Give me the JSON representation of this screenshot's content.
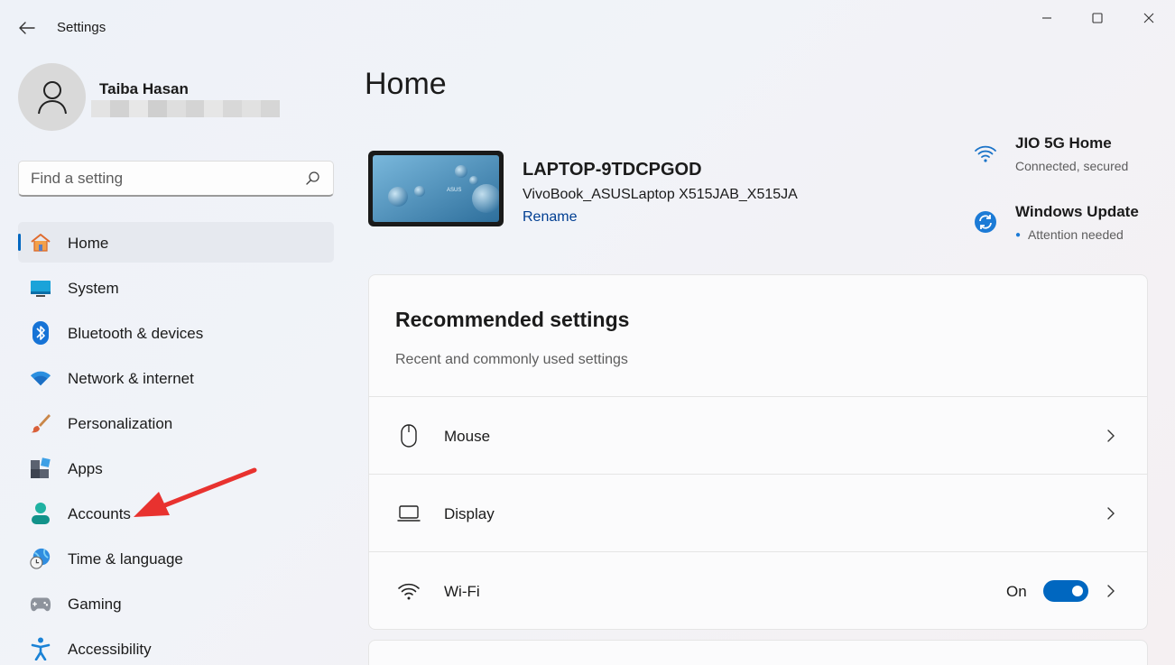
{
  "window": {
    "title": "Settings",
    "controls": [
      "minimize",
      "maximize",
      "close"
    ]
  },
  "profile": {
    "name": "Taiba Hasan"
  },
  "search": {
    "placeholder": "Find a setting"
  },
  "sidebar": {
    "items": [
      {
        "label": "Home",
        "icon": "home-icon",
        "active": true
      },
      {
        "label": "System",
        "icon": "system-icon"
      },
      {
        "label": "Bluetooth & devices",
        "icon": "bluetooth-icon"
      },
      {
        "label": "Network & internet",
        "icon": "network-icon"
      },
      {
        "label": "Personalization",
        "icon": "brush-icon"
      },
      {
        "label": "Apps",
        "icon": "apps-icon"
      },
      {
        "label": "Accounts",
        "icon": "accounts-icon"
      },
      {
        "label": "Time & language",
        "icon": "time-language-icon"
      },
      {
        "label": "Gaming",
        "icon": "gaming-icon"
      },
      {
        "label": "Accessibility",
        "icon": "accessibility-icon"
      }
    ]
  },
  "main": {
    "title": "Home",
    "device": {
      "name": "LAPTOP-9TDCPGOD",
      "model": "VivoBook_ASUSLaptop X515JAB_X515JA",
      "rename_label": "Rename",
      "wallpaper_brand": "ASUS"
    },
    "status": {
      "wifi": {
        "title": "JIO 5G Home",
        "subtitle": "Connected, secured"
      },
      "update": {
        "title": "Windows Update",
        "subtitle": "Attention needed"
      }
    },
    "recommended": {
      "title": "Recommended settings",
      "subtitle": "Recent and commonly used settings",
      "rows": [
        {
          "label": "Mouse",
          "icon": "mouse-icon"
        },
        {
          "label": "Display",
          "icon": "display-icon"
        },
        {
          "label": "Wi-Fi",
          "icon": "wifi-icon",
          "state": "On",
          "toggle_on": true
        }
      ]
    }
  },
  "colors": {
    "accent": "#0067c0",
    "link": "#003e92",
    "annotation_arrow": "#e8322f"
  }
}
